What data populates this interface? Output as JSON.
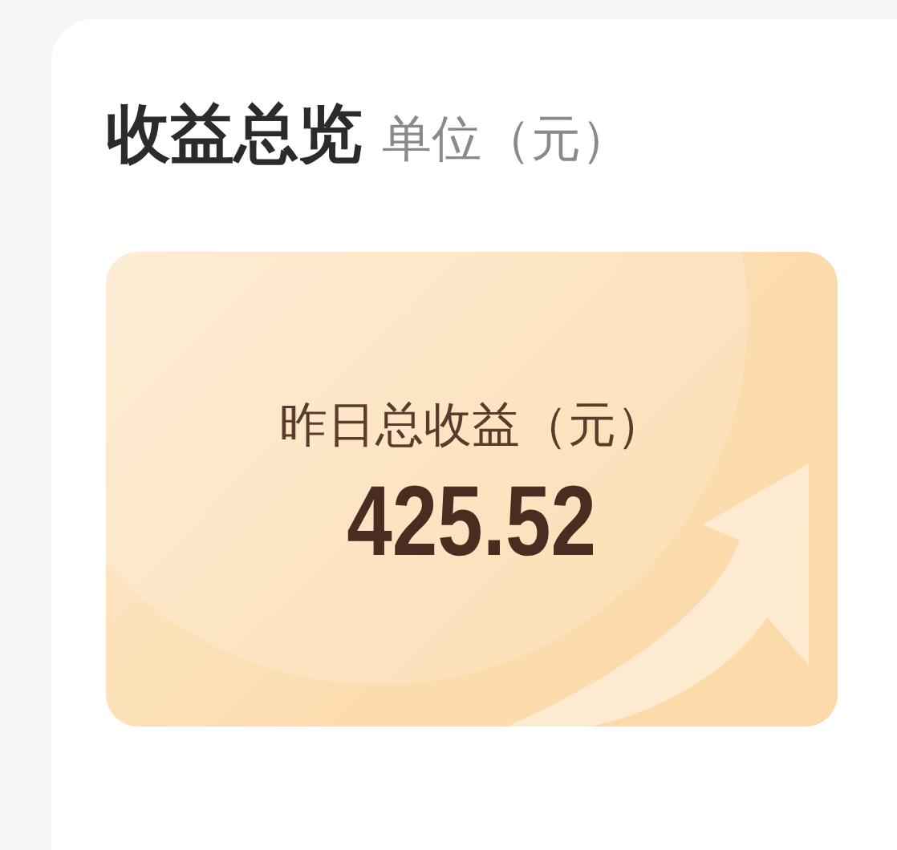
{
  "overview": {
    "title": "收益总览",
    "unit": "单位（元）"
  },
  "yesterday": {
    "label": "昨日总收益（元）",
    "value": "425.52"
  }
}
